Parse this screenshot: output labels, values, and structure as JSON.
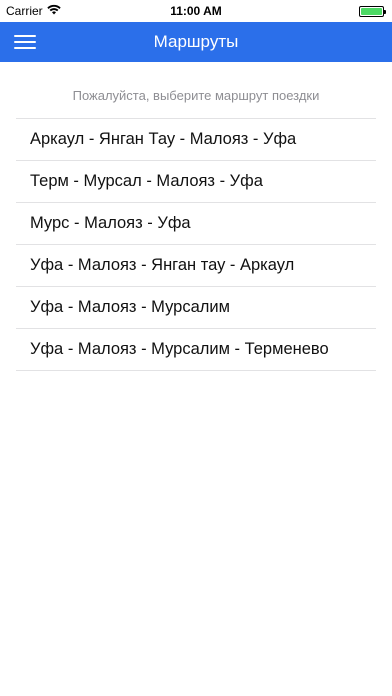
{
  "status_bar": {
    "carrier": "Carrier",
    "wifi_icon": "wifi-icon",
    "time": "11:00 AM",
    "battery_icon": "battery-icon",
    "battery_level": 1.0,
    "battery_color": "#4cd964"
  },
  "nav": {
    "title": "Маршруты",
    "menu_icon": "hamburger-menu-icon",
    "background_color": "#2b6fea"
  },
  "prompt": "Пожалуйста, выберите маршрут поездки",
  "routes": [
    {
      "label": "Аркаул - Янган Тау - Малояз - Уфа"
    },
    {
      "label": "Терм - Мурсал - Малояз - Уфа"
    },
    {
      "label": "Мурс - Малояз - Уфа"
    },
    {
      "label": "Уфа - Малояз - Янган тау - Аркаул"
    },
    {
      "label": "Уфа - Малояз - Мурсалим"
    },
    {
      "label": "Уфа - Малояз - Мурсалим - Терменево"
    }
  ]
}
